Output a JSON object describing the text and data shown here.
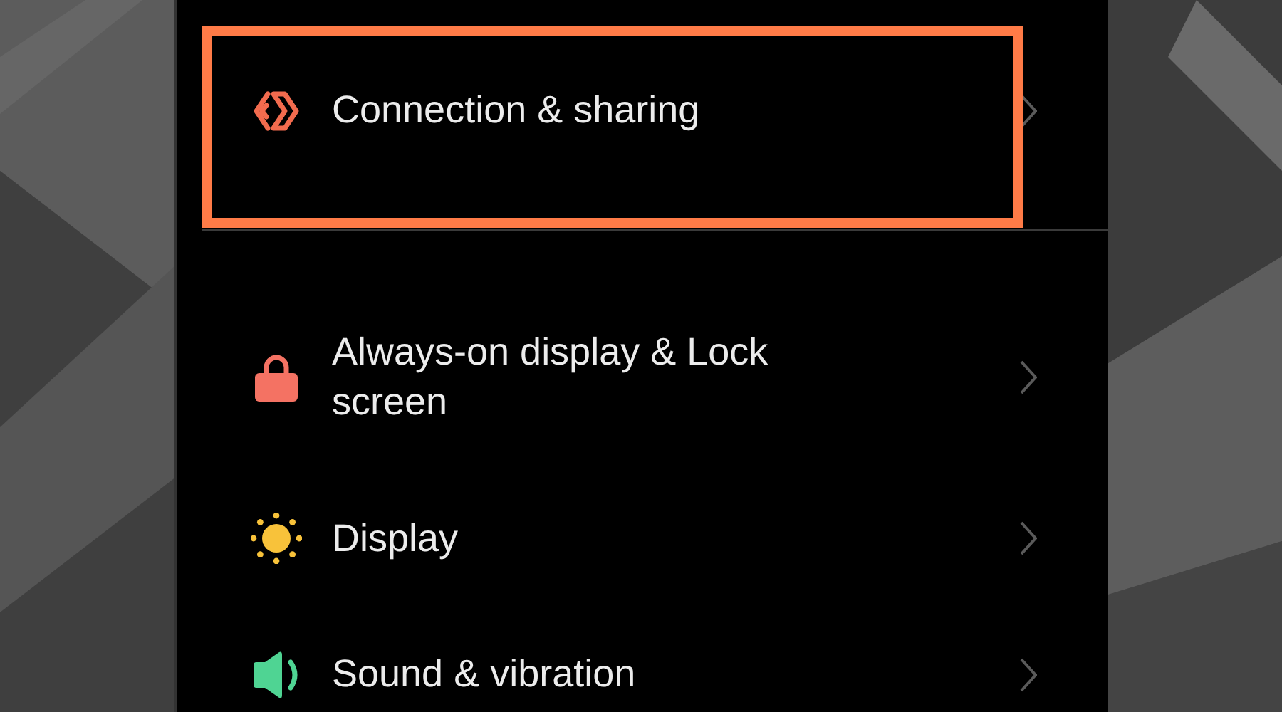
{
  "sections": [
    {
      "items": [
        {
          "kind": "connection",
          "label": "Connection & sharing",
          "highlighted": true
        }
      ]
    },
    {
      "items": [
        {
          "kind": "lock",
          "label": "Always-on display & Lock screen",
          "highlighted": false
        },
        {
          "kind": "display",
          "label": "Display",
          "highlighted": false
        },
        {
          "kind": "sound",
          "label": "Sound & vibration",
          "highlighted": false
        }
      ]
    }
  ]
}
